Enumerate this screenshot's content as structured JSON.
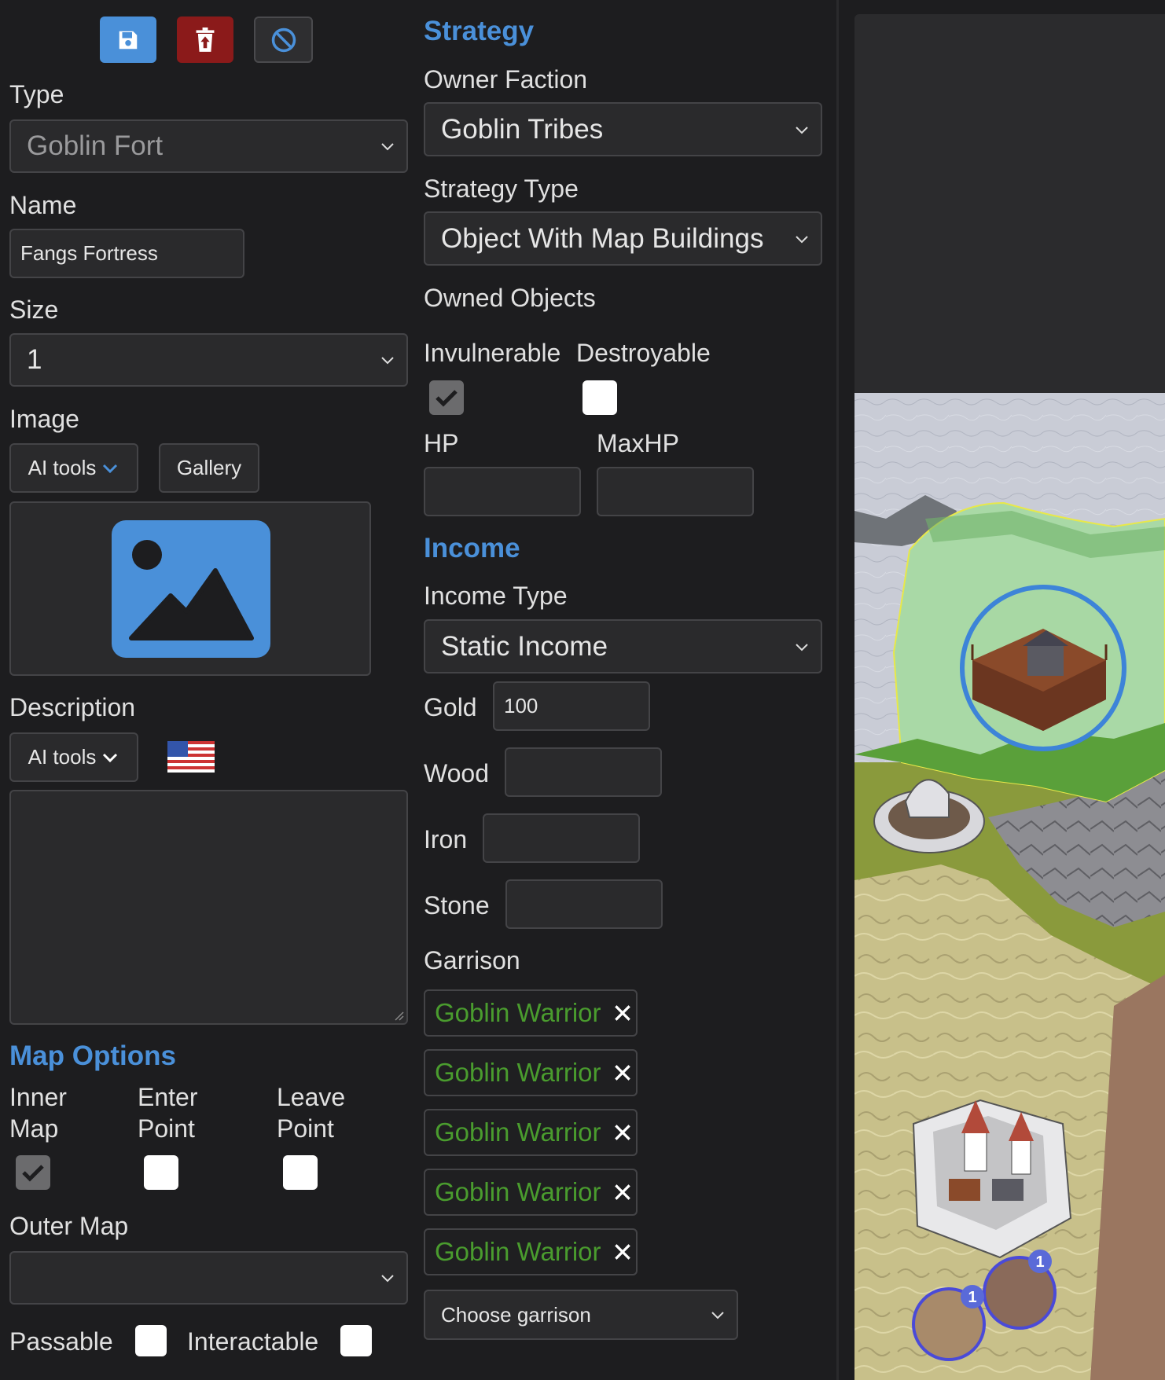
{
  "toolbar": {
    "save_icon": "save-icon",
    "delete_icon": "trash-upload-icon",
    "cancel_icon": "ban-icon"
  },
  "left": {
    "type_label": "Type",
    "type_value": "Goblin Fort",
    "name_label": "Name",
    "name_value": "Fangs Fortress",
    "size_label": "Size",
    "size_value": "1",
    "image_label": "Image",
    "ai_tools": "AI tools",
    "gallery": "Gallery",
    "description_label": "Description",
    "desc_ai_tools": "AI tools",
    "description_value": "",
    "map_options": "Map Options",
    "inner_map_l1": "Inner",
    "inner_map_l2": "Map",
    "enter_point_l1": "Enter",
    "enter_point_l2": "Point",
    "leave_point_l1": "Leave",
    "leave_point_l2": "Point",
    "inner_map_checked": true,
    "enter_point_checked": false,
    "leave_point_checked": false,
    "outer_map_label": "Outer Map",
    "outer_map_value": "",
    "passable_label": "Passable",
    "interactable_label": "Interactable"
  },
  "right": {
    "strategy": "Strategy",
    "owner_faction_label": "Owner Faction",
    "owner_faction_value": "Goblin Tribes",
    "strategy_type_label": "Strategy Type",
    "strategy_type_value": "Object With Map Buildings",
    "owned_objects_label": "Owned Objects",
    "invulnerable_label": "Invulnerable",
    "destroyable_label": "Destroyable",
    "invulnerable_checked": true,
    "destroyable_checked": false,
    "hp_label": "HP",
    "maxhp_label": "MaxHP",
    "hp_value": "",
    "maxhp_value": "",
    "income": "Income",
    "income_type_label": "Income Type",
    "income_type_value": "Static Income",
    "gold_label": "Gold",
    "gold_value": "100",
    "wood_label": "Wood",
    "iron_label": "Iron",
    "stone_label": "Stone",
    "garrison_label": "Garrison",
    "garrison": [
      "Goblin Warrior",
      "Goblin Warrior",
      "Goblin Warrior",
      "Goblin Warrior",
      "Goblin Warrior"
    ],
    "choose_garrison": "Choose garrison"
  },
  "map": {
    "badge_1": "1",
    "badge_2": "1"
  },
  "colors": {
    "accent": "#4a90d9",
    "danger": "#8b1a1a",
    "garrison_text": "#4a9c2e"
  }
}
